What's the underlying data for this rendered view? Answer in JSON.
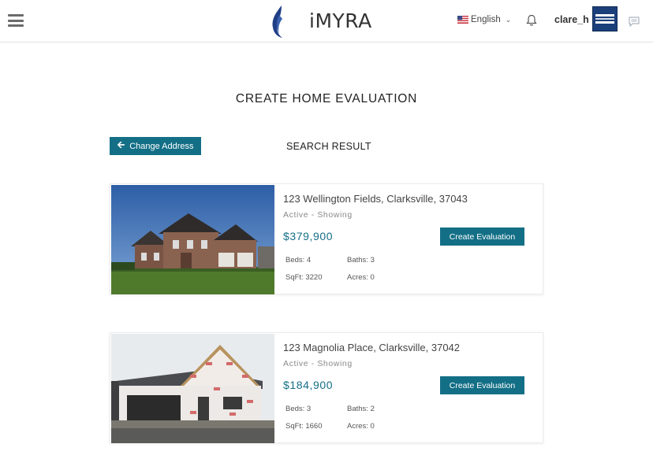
{
  "header": {
    "brand": "iMYRA",
    "language": "English",
    "username": "clare_h"
  },
  "page": {
    "title": "CREATE HOME EVALUATION",
    "change_address_label": "Change Address",
    "search_result_label": "SEARCH RESULT"
  },
  "listings": [
    {
      "address": "123 Wellington Fields, Clarksville, 37043",
      "status": "Active - Showing",
      "price": "$379,900",
      "button": "Create Evaluation",
      "beds": "Beds: 4",
      "baths": "Baths: 3",
      "sqft": "SqFt: 3220",
      "acres": "Acres: 0"
    },
    {
      "address": "123 Magnolia Place, Clarksville, 37042",
      "status": "Active - Showing",
      "price": "$184,900",
      "button": "Create Evaluation",
      "beds": "Beds: 3",
      "baths": "Baths: 2",
      "sqft": "SqFt: 1660",
      "acres": "Acres: 0"
    }
  ],
  "colors": {
    "accent": "#136f86",
    "brand_flame": "#1f3f86"
  },
  "icons": [
    "menu-icon",
    "flame-logo-icon",
    "us-flag-icon",
    "chevron-down-icon",
    "bell-icon",
    "chat-icon",
    "arrow-left-icon"
  ]
}
